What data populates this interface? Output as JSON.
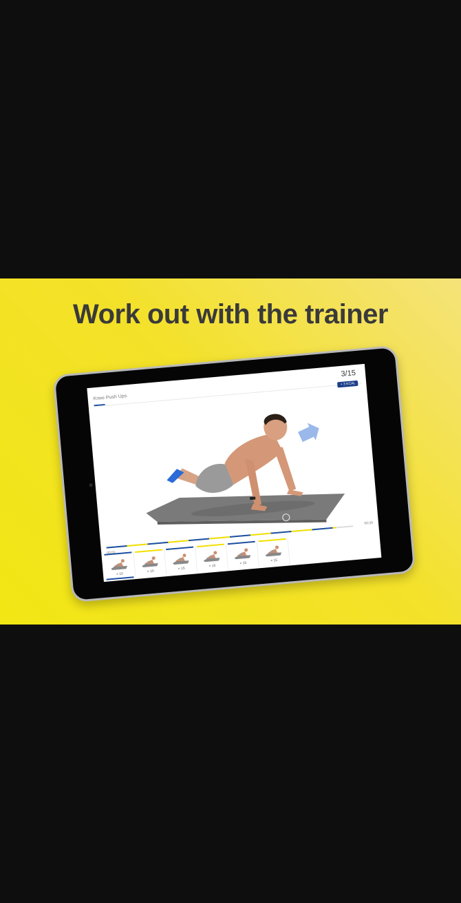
{
  "headline": "Work out with the trainer",
  "player": {
    "exercise_title": "Knee Push Ups",
    "counter": "3/15",
    "badge": "+ 3 KCAL",
    "progress": 0.93,
    "time_elapsed": "00:01",
    "time_total": "00:29"
  },
  "colors": {
    "accent_blue": "#1c4fa0",
    "accent_yellow": "#f2e000",
    "banner_yellow": "#f2e614"
  },
  "thumbnails": [
    {
      "reps": "× 15",
      "segment": "blue",
      "active": true
    },
    {
      "reps": "× 15",
      "segment": "yellow",
      "active": false
    },
    {
      "reps": "× 15",
      "segment": "blue",
      "active": false
    },
    {
      "reps": "× 15",
      "segment": "yellow",
      "active": false
    },
    {
      "reps": "× 15",
      "segment": "blue",
      "active": false
    },
    {
      "reps": "× 15",
      "segment": "yellow",
      "active": false
    }
  ]
}
